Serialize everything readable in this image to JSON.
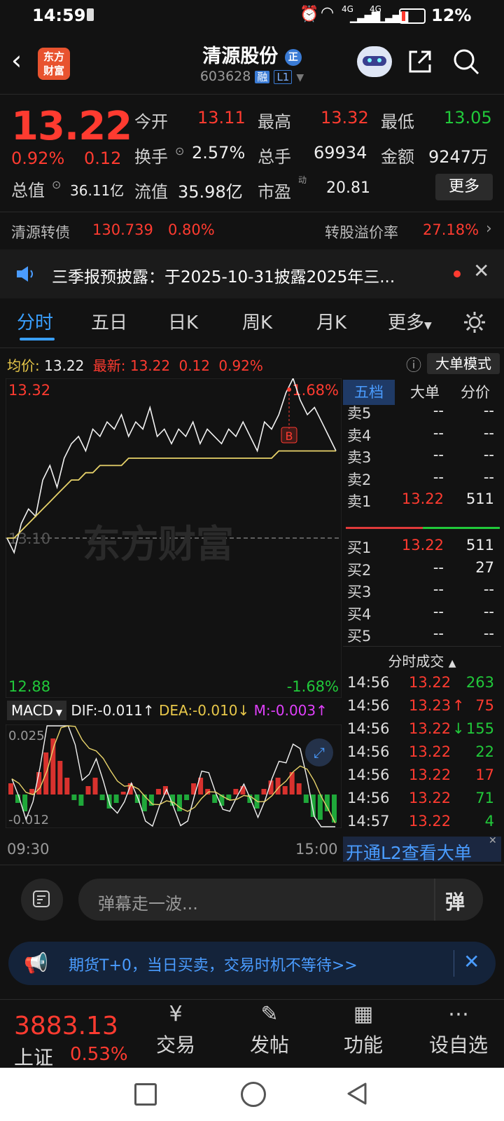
{
  "status": {
    "time": "14:59",
    "battery": "12%",
    "net1": "4G",
    "net2": "4G"
  },
  "header": {
    "title": "清源股份",
    "badge": "正",
    "code": "603628",
    "rong": "融",
    "level": "L1",
    "logo_line1": "东方",
    "logo_line2": "财富"
  },
  "quote": {
    "price": "13.22",
    "change_pct": "0.92%",
    "change": "0.12",
    "open_label": "今开",
    "open": "13.11",
    "high_label": "最高",
    "high": "13.32",
    "low_label": "最低",
    "low": "13.05",
    "turnover_label": "换手",
    "turnover": "2.57%",
    "volume_label": "总手",
    "volume": "69934",
    "amount_label": "金额",
    "amount": "9247万",
    "mcap_label": "总值",
    "mcap": "36.11亿",
    "float_label": "流值",
    "float": "35.98亿",
    "pe_label": "市盈",
    "pe_sup": "动",
    "pe": "20.81",
    "more_button": "更多"
  },
  "bond": {
    "name": "清源转债",
    "price": "130.739",
    "pct": "0.80%",
    "premium_label": "转股溢价率",
    "premium": "27.18%"
  },
  "notice": {
    "text": "三季报预披露：于2025-10-31披露2025年三..."
  },
  "tabs": [
    "分时",
    "五日",
    "日K",
    "周K",
    "月K",
    "更多"
  ],
  "chart_header": {
    "avg_label": "均价:",
    "avg": "13.22",
    "latest_label": "最新:",
    "latest": "13.22",
    "chg": "0.12",
    "pct": "0.92%",
    "mode_button": "大单模式"
  },
  "chart_data": {
    "type": "line",
    "ylim": [
      12.88,
      13.32
    ],
    "y_top_label": "13.32",
    "y_bottom_label": "12.88",
    "y_mid_label": "13.10",
    "pct_top_label": "1.68%",
    "pct_bottom_label": "-1.68%",
    "x_labels": [
      "09:30",
      "15:00"
    ],
    "watermark": "东方财富",
    "marker": "B",
    "series": [
      {
        "values": [
          13.1,
          13.08,
          13.12,
          13.14,
          13.13,
          13.18,
          13.2,
          13.17,
          13.21,
          13.23,
          13.24,
          13.22,
          13.25,
          13.24,
          13.26,
          13.25,
          13.27,
          13.24,
          13.26,
          13.25,
          13.28,
          13.24,
          13.25,
          13.23,
          13.25,
          13.24,
          13.26,
          13.23,
          13.25,
          13.24,
          13.23,
          13.25,
          13.24,
          13.26,
          13.24,
          13.22,
          13.26,
          13.25,
          13.27,
          13.3,
          13.32,
          13.29,
          13.27,
          13.28,
          13.26,
          13.24,
          13.22
        ]
      },
      {
        "values": [
          13.1,
          13.1,
          13.11,
          13.12,
          13.13,
          13.14,
          13.15,
          13.16,
          13.17,
          13.18,
          13.18,
          13.19,
          13.19,
          13.2,
          13.2,
          13.2,
          13.2,
          13.21,
          13.21,
          13.21,
          13.21,
          13.21,
          13.21,
          13.21,
          13.21,
          13.21,
          13.21,
          13.21,
          13.21,
          13.21,
          13.21,
          13.21,
          13.21,
          13.21,
          13.21,
          13.21,
          13.21,
          13.21,
          13.22,
          13.22,
          13.22,
          13.22,
          13.22,
          13.22,
          13.22,
          13.22,
          13.22
        ]
      }
    ]
  },
  "macd": {
    "label": "MACD",
    "dif": "DIF:-0.011",
    "dea": "DEA:-0.010",
    "m": "M:-0.003",
    "top": "0.025",
    "bottom": "-0.012",
    "hist": [
      0.004,
      -0.003,
      -0.006,
      0.002,
      0.008,
      0.015,
      0.02,
      0.012,
      0.006,
      -0.002,
      -0.004,
      0.003,
      0.006,
      -0.002,
      -0.005,
      -0.003,
      0.001,
      0.004,
      -0.003,
      -0.006,
      -0.004,
      0.002,
      0.003,
      -0.004,
      -0.006,
      -0.002,
      0.004,
      0.006,
      0.002,
      -0.003,
      -0.004,
      -0.002,
      0.002,
      0.003,
      -0.003,
      -0.005,
      0.002,
      0.005,
      0.006,
      0.003,
      0.008,
      0.004,
      -0.003,
      -0.008,
      -0.009,
      -0.006,
      -0.01
    ]
  },
  "orderbook": {
    "tabs": [
      "五档",
      "大单",
      "分价"
    ],
    "sell": [
      {
        "label": "卖5",
        "price": "--",
        "vol": "--"
      },
      {
        "label": "卖4",
        "price": "--",
        "vol": "--"
      },
      {
        "label": "卖3",
        "price": "--",
        "vol": "--"
      },
      {
        "label": "卖2",
        "price": "--",
        "vol": "--"
      },
      {
        "label": "卖1",
        "price": "13.22",
        "vol": "511"
      }
    ],
    "buy": [
      {
        "label": "买1",
        "price": "13.22",
        "vol": "511"
      },
      {
        "label": "买2",
        "price": "--",
        "vol": "27"
      },
      {
        "label": "买3",
        "price": "--",
        "vol": "--"
      },
      {
        "label": "买4",
        "price": "--",
        "vol": "--"
      },
      {
        "label": "买5",
        "price": "--",
        "vol": "--"
      }
    ]
  },
  "trades": {
    "title": "分时成交",
    "rows": [
      {
        "time": "14:56",
        "price": "13.22",
        "vol": "263",
        "arrow": ""
      },
      {
        "time": "14:56",
        "price": "13.23",
        "vol": "75",
        "arrow": "↑"
      },
      {
        "time": "14:56",
        "price": "13.22",
        "vol": "155",
        "arrow": "↓"
      },
      {
        "time": "14:56",
        "price": "13.22",
        "vol": "22",
        "arrow": ""
      },
      {
        "time": "14:56",
        "price": "13.22",
        "vol": "17",
        "arrow": ""
      },
      {
        "time": "14:56",
        "price": "13.22",
        "vol": "71",
        "arrow": ""
      },
      {
        "time": "14:57",
        "price": "13.22",
        "vol": "4",
        "arrow": ""
      }
    ],
    "l2_banner": "开通L2查看大单"
  },
  "comment": {
    "placeholder": "弹幕走一波...",
    "danmu": "弹"
  },
  "ad": {
    "text": "期货T+0，当日买卖，交易时机不等待>>"
  },
  "bottom_nav": {
    "index_value": "3883.13",
    "index_name": "上证",
    "index_pct": "0.53%",
    "items": [
      "交易",
      "发帖",
      "功能",
      "设自选"
    ]
  }
}
